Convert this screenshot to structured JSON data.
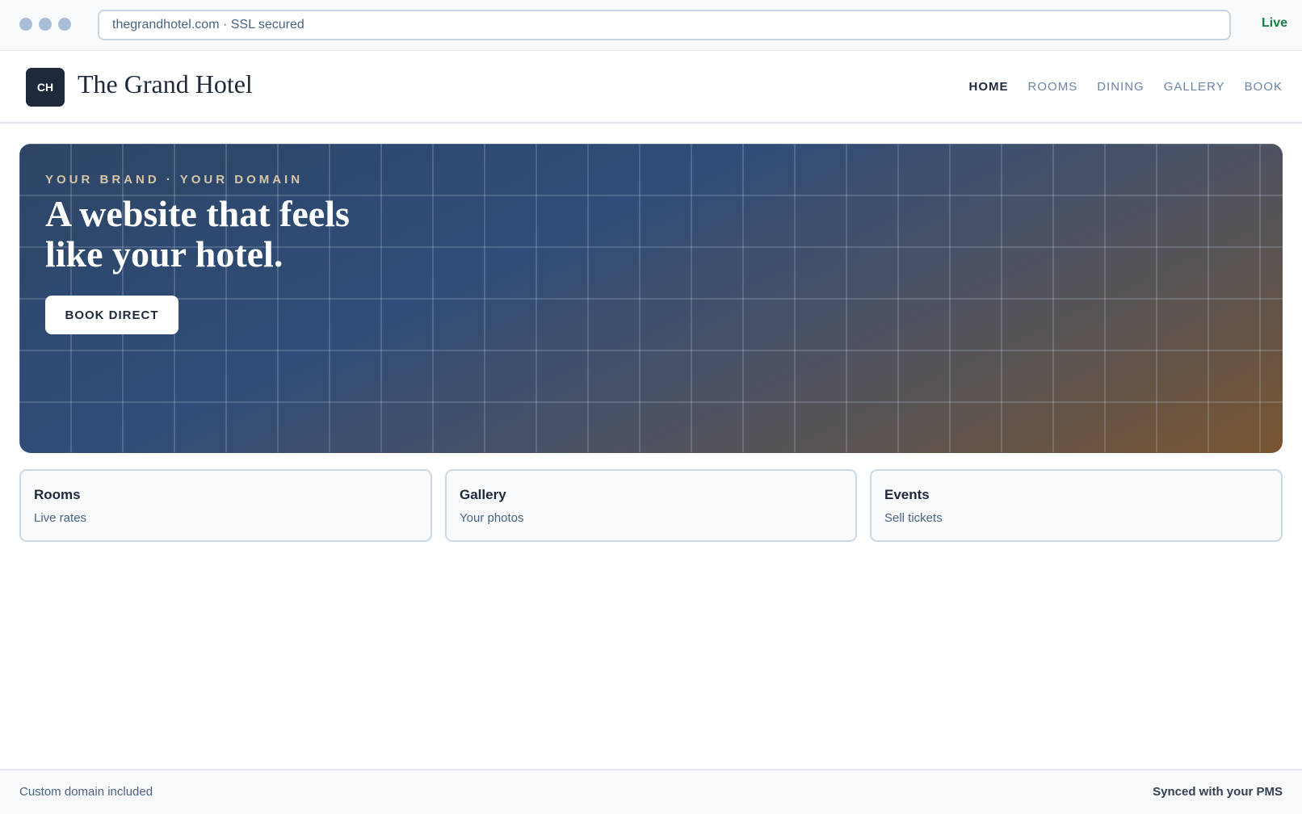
{
  "browser": {
    "url": "thegrandhotel.com · SSL secured",
    "status": "Live"
  },
  "header": {
    "logo_initials": "CH",
    "hotel_name": "The Grand Hotel",
    "nav": [
      "HOME",
      "ROOMS",
      "DINING",
      "GALLERY",
      "BOOK"
    ],
    "active_nav": "HOME"
  },
  "hero": {
    "eyebrow": "YOUR BRAND · YOUR DOMAIN",
    "headline": "A website that feels like your hotel.",
    "cta_label": "BOOK DIRECT"
  },
  "cards": [
    {
      "title": "Rooms",
      "subtitle": "Live rates"
    },
    {
      "title": "Gallery",
      "subtitle": "Your photos"
    },
    {
      "title": "Events",
      "subtitle": "Sell tickets"
    }
  ],
  "footer": {
    "left": "Custom domain included",
    "right": "Synced with your PMS"
  },
  "colors": {
    "status_live": "#15803d",
    "logo_bg": "#1e293b",
    "hero_gradient_start": "#2e4566",
    "hero_gradient_end": "#7a5530"
  }
}
